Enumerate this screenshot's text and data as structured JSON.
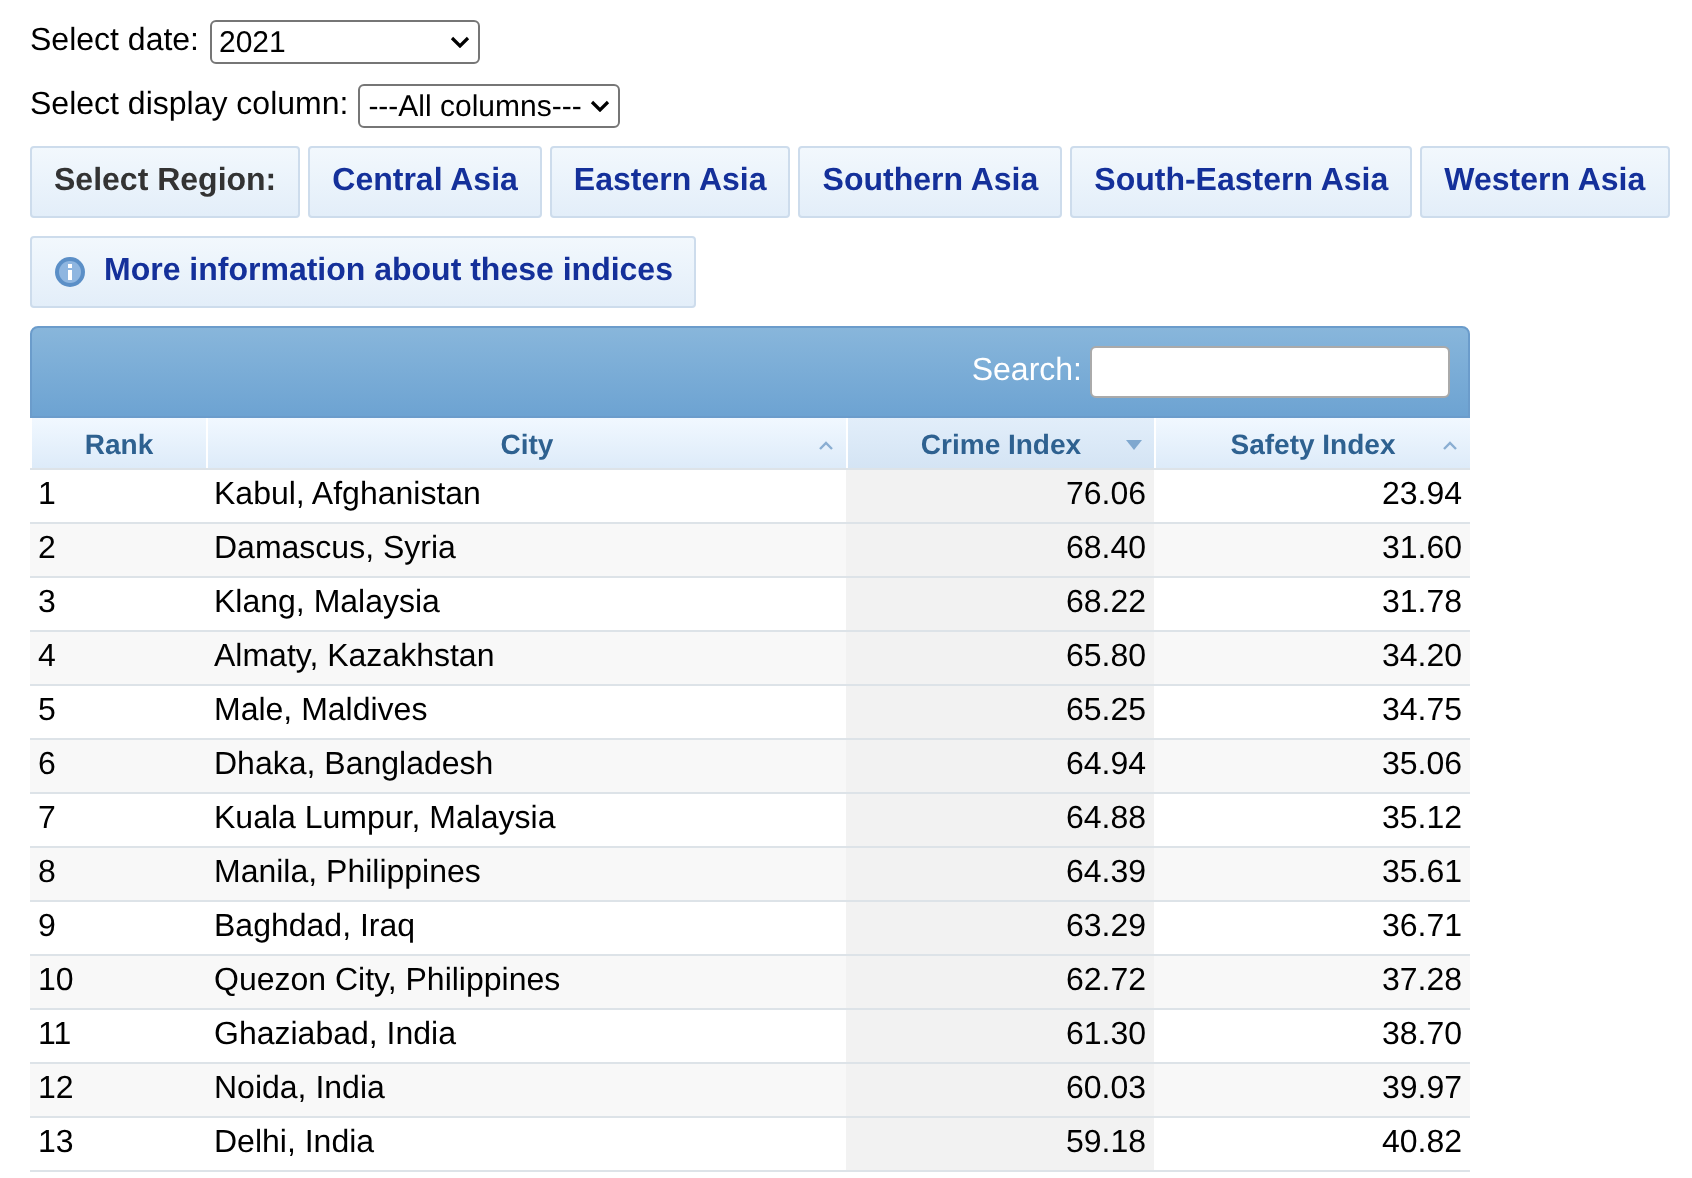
{
  "date_select": {
    "label": "Select date:",
    "value": "2021"
  },
  "column_select": {
    "label": "Select display column:",
    "value": "---All columns---"
  },
  "region_bar": {
    "label": "Select Region:",
    "regions": [
      "Central Asia",
      "Eastern Asia",
      "Southern Asia",
      "South-Eastern Asia",
      "Western Asia"
    ]
  },
  "info_button": "More information about these indices",
  "table": {
    "search_label": "Search:",
    "columns": [
      {
        "label": "Rank",
        "sortable": false,
        "sorted": false,
        "kind": "text"
      },
      {
        "label": "City",
        "sortable": true,
        "sorted": false,
        "kind": "text"
      },
      {
        "label": "Crime Index",
        "sortable": true,
        "sorted": true,
        "kind": "number"
      },
      {
        "label": "Safety Index",
        "sortable": true,
        "sorted": false,
        "kind": "number"
      }
    ],
    "rows": [
      [
        "1",
        "Kabul, Afghanistan",
        "76.06",
        "23.94"
      ],
      [
        "2",
        "Damascus, Syria",
        "68.40",
        "31.60"
      ],
      [
        "3",
        "Klang, Malaysia",
        "68.22",
        "31.78"
      ],
      [
        "4",
        "Almaty, Kazakhstan",
        "65.80",
        "34.20"
      ],
      [
        "5",
        "Male, Maldives",
        "65.25",
        "34.75"
      ],
      [
        "6",
        "Dhaka, Bangladesh",
        "64.94",
        "35.06"
      ],
      [
        "7",
        "Kuala Lumpur, Malaysia",
        "64.88",
        "35.12"
      ],
      [
        "8",
        "Manila, Philippines",
        "64.39",
        "35.61"
      ],
      [
        "9",
        "Baghdad, Iraq",
        "63.29",
        "36.71"
      ],
      [
        "10",
        "Quezon City, Philippines",
        "62.72",
        "37.28"
      ],
      [
        "11",
        "Ghaziabad, India",
        "61.30",
        "38.70"
      ],
      [
        "12",
        "Noida, India",
        "60.03",
        "39.97"
      ],
      [
        "13",
        "Delhi, India",
        "59.18",
        "40.82"
      ]
    ]
  }
}
